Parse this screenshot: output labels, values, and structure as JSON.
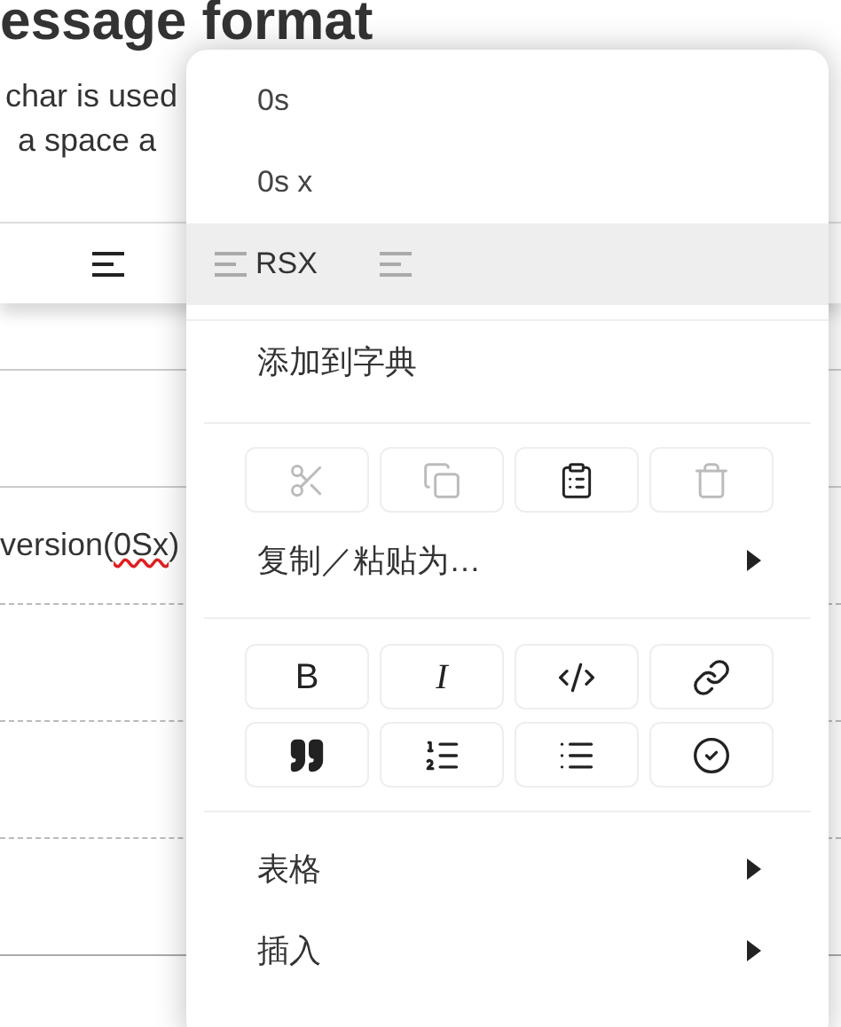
{
  "document": {
    "heading": "essage format",
    "paragraph_lines": [
      "char is used",
      "a space a"
    ],
    "table_rows": [
      {
        "cell": null
      },
      {
        "cell": {
          "before": "version(",
          "flagged": "0Sx",
          "after": ")"
        }
      },
      {
        "cell": null
      },
      {
        "cell": null
      },
      {
        "cell": null
      }
    ]
  },
  "context_menu": {
    "suggestions": [
      {
        "label": "0s",
        "selected": false
      },
      {
        "label": "0s x",
        "selected": false
      },
      {
        "label": "RSX",
        "selected": true
      }
    ],
    "add_to_dictionary": "添加到字典",
    "edit_buttons": [
      {
        "kind": "cut",
        "disabled": true
      },
      {
        "kind": "copy",
        "disabled": true
      },
      {
        "kind": "paste",
        "disabled": false
      },
      {
        "kind": "delete",
        "disabled": true
      }
    ],
    "copy_paste_as": "复制／粘贴为…",
    "format_buttons": [
      {
        "kind": "bold",
        "label": "B"
      },
      {
        "kind": "italic",
        "label": "I"
      },
      {
        "kind": "code"
      },
      {
        "kind": "link"
      },
      {
        "kind": "quote"
      },
      {
        "kind": "ordered-list"
      },
      {
        "kind": "bullet-list"
      },
      {
        "kind": "task"
      }
    ],
    "submenus": [
      "表格",
      "插入"
    ]
  }
}
